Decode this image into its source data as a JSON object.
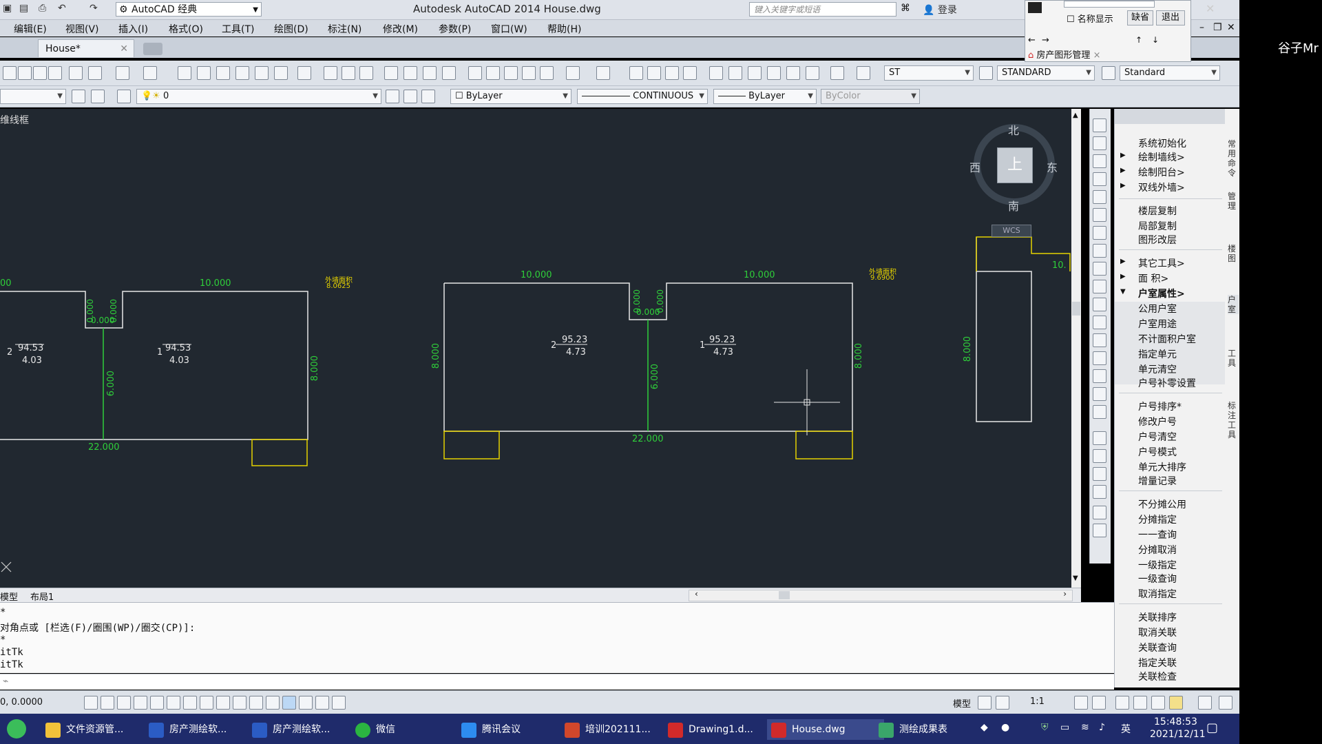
{
  "window": {
    "title": "Autodesk AutoCAD 2014    House.dwg",
    "workspace": "AutoCAD 经典",
    "search_placeholder": "键入关键字或短语",
    "login_label": "登录"
  },
  "menu": [
    "编辑(E)",
    "视图(V)",
    "插入(I)",
    "格式(O)",
    "工具(T)",
    "绘图(D)",
    "标注(N)",
    "修改(M)",
    "参数(P)",
    "窗口(W)",
    "帮助(H)"
  ],
  "tabs": {
    "doc_tab": "House*"
  },
  "toolbar": {
    "text_style": "ST",
    "dim_style": "STANDARD",
    "table_style": "Standard",
    "layer_value": "0",
    "color": "ByLayer",
    "linetype": "CONTINUOUS",
    "lineweight": "ByLayer",
    "plotstyle": "ByColor"
  },
  "dialog": {
    "checkbox_label": "名称显示",
    "btn_default": "缺省",
    "btn_exit": "退出",
    "panel_title": "房产图形管理"
  },
  "drawing": {
    "view_label": "维线框",
    "viewcube": {
      "north": "北",
      "south": "南",
      "west": "西",
      "east": "东",
      "top": "上",
      "wcs": "WCS"
    },
    "dims_left": {
      "top_left": "00",
      "top_right": "10.000",
      "notch_a": "0.000",
      "notch_b": "0.000",
      "notch_c": "0.000",
      "center": "6.000",
      "right": "8.000",
      "bottom": "22.000"
    },
    "room_left_a": {
      "id": "2",
      "area": "94.53",
      "sub": "4.03"
    },
    "room_left_b": {
      "id": "1",
      "area": "94.53",
      "sub": "4.03"
    },
    "note_left": {
      "title": "外墙面积",
      "value": "8.0625"
    },
    "dims_mid": {
      "top_left": "10.000",
      "top_right": "10.000",
      "notch_a": "0.000",
      "notch_b": "0.000",
      "notch_c": "0.000",
      "center": "6.000",
      "left": "8.000",
      "right": "8.000",
      "bottom": "22.000"
    },
    "room_mid_a": {
      "id": "2",
      "area": "95.23",
      "sub": "4.73"
    },
    "room_mid_b": {
      "id": "1",
      "area": "95.23",
      "sub": "4.73"
    },
    "note_right": {
      "title": "外墙面积",
      "value": "9.6900"
    },
    "dims_right": {
      "left": "8.000",
      "top": "10."
    }
  },
  "layout_tabs": [
    "模型",
    "布局1"
  ],
  "panel": {
    "sections": [
      [
        "系统初始化",
        "绘制墙线>",
        "绘制阳台>",
        "双线外墙>"
      ],
      [
        "楼层复制",
        "局部复制",
        "图形改层"
      ],
      [
        "其它工具>",
        "面    积>",
        "户室属性>",
        "公用户室",
        "户室用途",
        "不计面积户室",
        "指定单元",
        "单元清空",
        "户号补零设置"
      ],
      [
        "户号排序*",
        "修改户号",
        "户号清空",
        "户号模式",
        "单元大排序",
        "增量记录"
      ],
      [
        "不分摊公用",
        "分摊指定",
        "一一查询",
        "分摊取消",
        "一级指定",
        "一级查询",
        "取消指定"
      ],
      [
        "关联排序",
        "取消关联",
        "关联查询",
        "指定关联",
        "关联检查"
      ]
    ],
    "side_tabs": [
      "常用命令",
      "管理",
      "楼图",
      "户室",
      "工具",
      "标注工具"
    ]
  },
  "command": {
    "lines": [
      "*",
      "对角点或 [栏选(F)/圈围(WP)/圈交(CP)]:",
      "*",
      "itTk",
      "itTk"
    ]
  },
  "status": {
    "coords": "0, 0.0000",
    "model": "模型",
    "scale": "1:1"
  },
  "taskbar": {
    "apps": [
      "文件资源管...",
      "房产测绘软...",
      "房产测绘软...",
      "微信",
      "腾讯会议",
      "培训202111...",
      "Drawing1.d...",
      "House.dwg",
      "测绘成果表"
    ],
    "ime": "英",
    "time": "15:48:53",
    "date": "2021/12/11"
  },
  "user_label": "谷子Mr",
  "colors": {
    "canvas": "#212830",
    "line_white": "#e8e8e8",
    "line_yellow": "#e5d200",
    "line_green": "#2fcf3a",
    "taskbar": "#1f2b6b"
  }
}
